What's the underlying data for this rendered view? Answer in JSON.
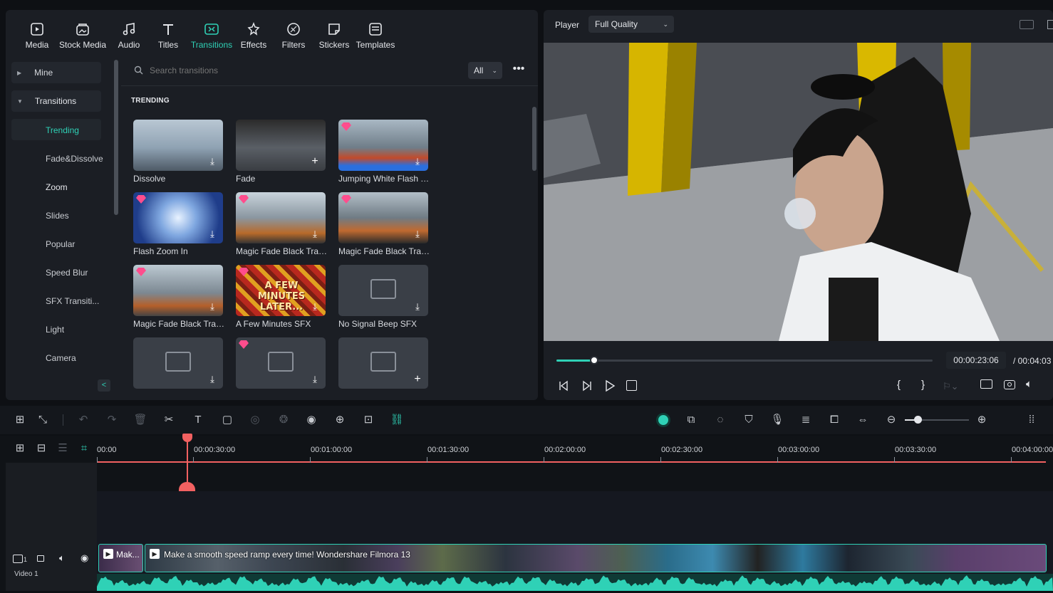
{
  "toolbar": {
    "items": [
      {
        "label": "Media",
        "icon": "media-icon"
      },
      {
        "label": "Stock Media",
        "icon": "stock-media-icon"
      },
      {
        "label": "Audio",
        "icon": "audio-icon"
      },
      {
        "label": "Titles",
        "icon": "titles-icon"
      },
      {
        "label": "Transitions",
        "icon": "transitions-icon",
        "active": true
      },
      {
        "label": "Effects",
        "icon": "effects-icon"
      },
      {
        "label": "Filters",
        "icon": "filters-icon"
      },
      {
        "label": "Stickers",
        "icon": "stickers-icon"
      },
      {
        "label": "Templates",
        "icon": "templates-icon"
      }
    ]
  },
  "sidebar": {
    "mine": "Mine",
    "transitions": "Transitions",
    "items": [
      "Trending",
      "Fade&Dissolve",
      "Zoom",
      "Slides",
      "Popular",
      "Speed Blur",
      "SFX Transiti...",
      "Light",
      "Camera"
    ],
    "selected": "Trending"
  },
  "search": {
    "placeholder": "Search transitions",
    "filter": "All"
  },
  "section_title": "TRENDING",
  "transitions": [
    {
      "label": "Dissolve",
      "premium": false,
      "action": "download"
    },
    {
      "label": "Fade",
      "premium": false,
      "action": "add"
    },
    {
      "label": "Jumping White Flash T...",
      "premium": true,
      "action": "download"
    },
    {
      "label": "Flash Zoom In",
      "premium": true,
      "action": "download"
    },
    {
      "label": "Magic Fade Black Tran...",
      "premium": true,
      "action": "download"
    },
    {
      "label": "Magic Fade Black Tran...",
      "premium": true,
      "action": "download"
    },
    {
      "label": "Magic Fade Black Tran...",
      "premium": true,
      "action": "download"
    },
    {
      "label": "A Few Minutes SFX",
      "premium": true,
      "action": "download"
    },
    {
      "label": "No Signal Beep SFX",
      "premium": false,
      "action": "download"
    },
    {
      "label": "",
      "premium": false,
      "action": "download"
    },
    {
      "label": "",
      "premium": true,
      "action": "download"
    },
    {
      "label": "",
      "premium": false,
      "action": "add"
    }
  ],
  "thumb_texts": {
    "few_minutes": "A FEW MINUTES LATER..."
  },
  "player": {
    "label": "Player",
    "quality": "Full Quality",
    "current_time": "00:00:23:06",
    "total_time": "/ 00:04:03",
    "progress": 0.1
  },
  "timeline": {
    "ruler": [
      "00:00",
      "00:00:30:00",
      "00:01:00:00",
      "00:01:30:00",
      "00:02:00:00",
      "00:02:30:00",
      "00:03:00:00",
      "00:03:30:00",
      "00:04:00:00"
    ],
    "track_name": "Video 1",
    "track_number": "1",
    "clip1": "Mak...",
    "clip2": "Make a smooth speed ramp every time! Wondershare Filmora 13",
    "zoom_level": 0.2
  },
  "colors": {
    "accent": "#2fd1b6",
    "playhead": "#f26161",
    "premium": "#ff4d8d"
  }
}
